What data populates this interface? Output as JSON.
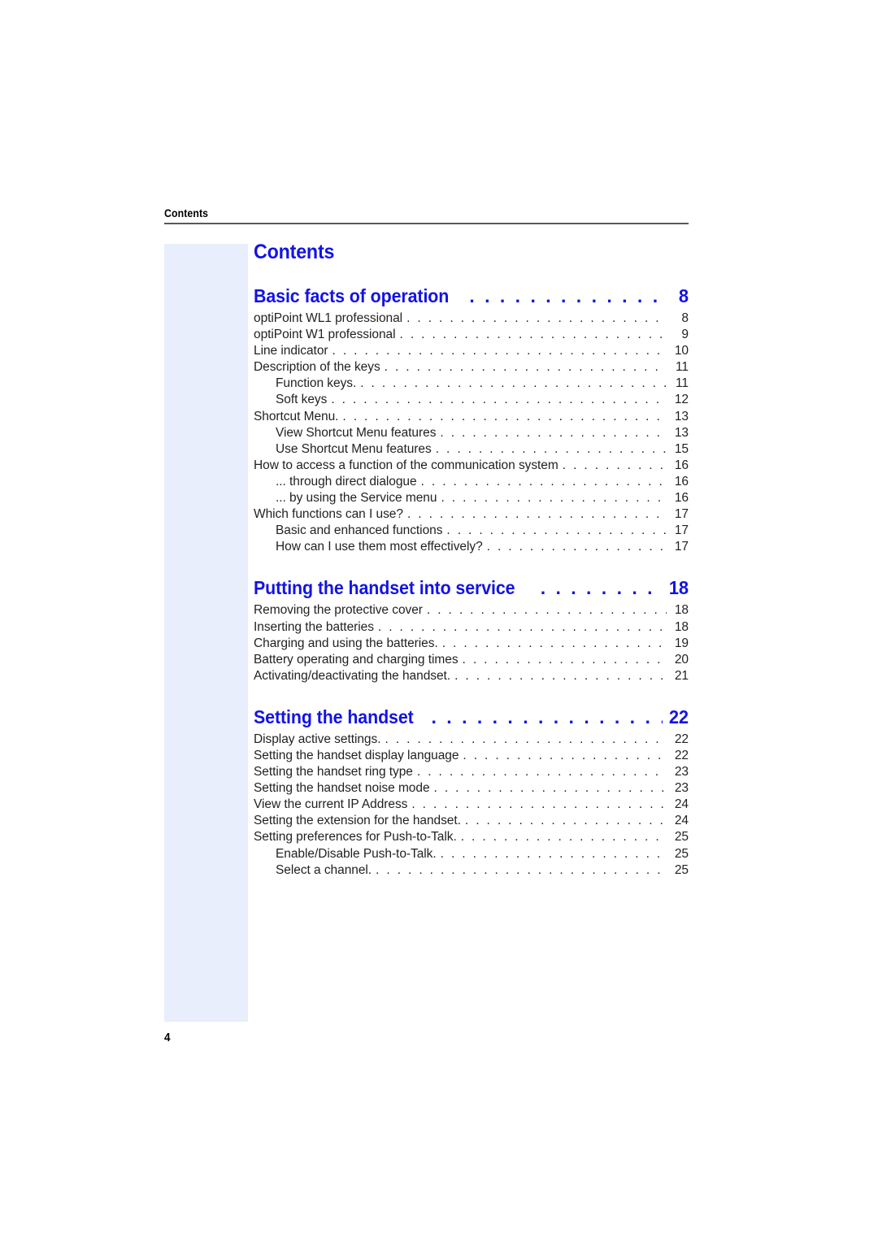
{
  "running_head": "Contents",
  "folio": "4",
  "doc_title": "Contents",
  "colors": {
    "accent_blue": "#1313e5",
    "band_blue": "#e8eefb",
    "body_text": "#231f20",
    "rule": "#58595b"
  },
  "sections": [
    {
      "title": "Basic facts of operation",
      "page": "8",
      "entries": [
        {
          "label": "optiPoint WL1 professional",
          "page": "8",
          "level": 1
        },
        {
          "label": "optiPoint W1 professional",
          "page": "9",
          "level": 1
        },
        {
          "label": "Line indicator",
          "page": "10",
          "level": 1
        },
        {
          "label": "Description of the keys",
          "page": "11",
          "level": 1
        },
        {
          "label": "Function keys.",
          "page": "11",
          "level": 2
        },
        {
          "label": "Soft keys",
          "page": "12",
          "level": 2
        },
        {
          "label": "Shortcut Menu.",
          "page": "13",
          "level": 1
        },
        {
          "label": "View Shortcut Menu features",
          "page": "13",
          "level": 2
        },
        {
          "label": "Use Shortcut Menu features",
          "page": "15",
          "level": 2
        },
        {
          "label": "How to access a function of the communication system",
          "page": "16",
          "level": 1
        },
        {
          "label": "... through direct dialogue",
          "page": "16",
          "level": 2
        },
        {
          "label": "... by using the Service menu",
          "page": "16",
          "level": 2
        },
        {
          "label": "Which functions can I use?",
          "page": "17",
          "level": 1
        },
        {
          "label": "Basic and enhanced functions",
          "page": "17",
          "level": 2
        },
        {
          "label": "How can I use them most effectively?",
          "page": "17",
          "level": 2
        }
      ]
    },
    {
      "title": "Putting the handset into service",
      "page": "18",
      "entries": [
        {
          "label": "Removing the protective cover",
          "page": "18",
          "level": 1
        },
        {
          "label": "Inserting the batteries",
          "page": "18",
          "level": 1
        },
        {
          "label": "Charging and using the batteries.",
          "page": "19",
          "level": 1
        },
        {
          "label": "Battery operating and charging times",
          "page": "20",
          "level": 1
        },
        {
          "label": "Activating/deactivating the handset.",
          "page": "21",
          "level": 1
        }
      ]
    },
    {
      "title": "Setting the handset",
      "page": "22",
      "entries": [
        {
          "label": "Display active settings.",
          "page": "22",
          "level": 1
        },
        {
          "label": "Setting the handset display language",
          "page": "22",
          "level": 1
        },
        {
          "label": "Setting the handset ring type",
          "page": "23",
          "level": 1
        },
        {
          "label": "Setting the handset noise mode",
          "page": "23",
          "level": 1
        },
        {
          "label": "View the current IP Address",
          "page": "24",
          "level": 1
        },
        {
          "label": "Setting the extension for the handset.",
          "page": "24",
          "level": 1
        },
        {
          "label": "Setting preferences for Push-to-Talk.",
          "page": "25",
          "level": 1
        },
        {
          "label": "Enable/Disable Push-to-Talk.",
          "page": "25",
          "level": 2
        },
        {
          "label": "Select a channel.",
          "page": "25",
          "level": 2
        }
      ]
    }
  ]
}
